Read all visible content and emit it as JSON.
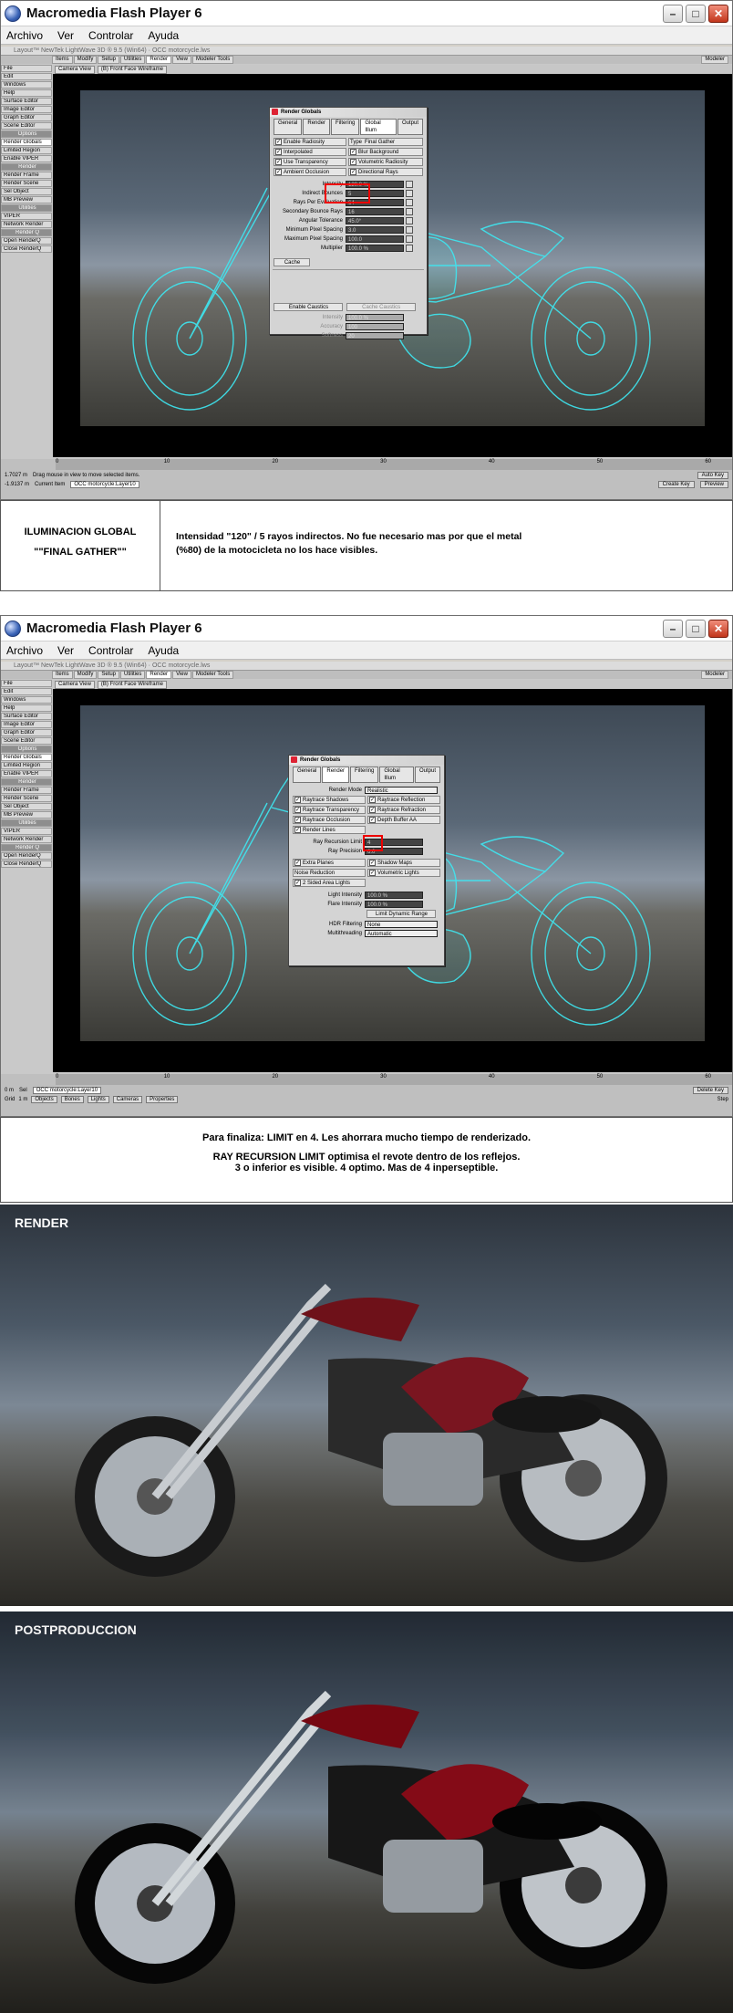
{
  "window": {
    "title": "Macromedia Flash Player 6"
  },
  "menu": [
    "Archivo",
    "Ver",
    "Controlar",
    "Ayuda"
  ],
  "lightwave": {
    "title": "Layout™ NewTek LightWave 3D ® 9.5 (Win64) · OCC motorcycle.lws",
    "tabs": [
      "Items",
      "Modify",
      "Setup",
      "Utilities",
      "Render",
      "View",
      "Modeler Tools"
    ],
    "modeler_label": "Modeler",
    "sidebar": [
      "File",
      "Edit",
      "Windows",
      "Help",
      "Surface Editor",
      "Image Editor",
      "Graph Editor",
      "Scene Editor",
      "Options",
      "Render Globals",
      "Limited Region",
      "Enable VIPER",
      "Render",
      "Render Frame",
      "Render Scene",
      "Sel Object",
      "MB Preview",
      "Utilities",
      "VIPER",
      "Network Render",
      "Render Q",
      "Open RenderQ",
      "Close RenderQ"
    ],
    "viewport_bar": [
      "Camera View",
      "(B) Front Face Wireframe"
    ],
    "timeline_ticks": [
      "0",
      "10",
      "20",
      "30",
      "40",
      "50",
      "60"
    ],
    "status_text": "Drag mouse in view to move selected items.",
    "position_label": "Position",
    "grid_label": "Grid",
    "current_item_label": "Current Item",
    "current_item_value": "OCC motorcycle:Layer10",
    "sel_label": "Sel",
    "item_buttons": [
      "Objects",
      "Bones",
      "Lights",
      "Cameras",
      "Properties"
    ],
    "key_buttons": [
      "Auto Key",
      "Create Key",
      "Delete Key"
    ],
    "preview_label": "Preview",
    "step_label": "Step",
    "x_value": "1.7027 m",
    "y_value": "0 m",
    "z_value": "-1.9137 m",
    "grid_value": "1 m"
  },
  "dialog1": {
    "title": "Render Globals",
    "tabs": [
      "General",
      "Render",
      "Filtering",
      "Global Illum",
      "Output"
    ],
    "checks_left": [
      "Enable Radiosity",
      "Interpolated",
      "Use Transparency",
      "Ambient Occlusion"
    ],
    "type_label": "Type",
    "type_value": "Final Gather",
    "checks_right": [
      "Blur Background",
      "Volumetric Radiosity",
      "Directional Rays"
    ],
    "fields": [
      {
        "label": "Intensity",
        "value": "120.0 %"
      },
      {
        "label": "Indirect Bounces",
        "value": "5"
      },
      {
        "label": "Rays Per Evaluation",
        "value": "64"
      },
      {
        "label": "Secondary Bounce Rays",
        "value": "16"
      },
      {
        "label": "Angular Tolerance",
        "value": "45.0°"
      },
      {
        "label": "Minimum Pixel Spacing",
        "value": "3.0"
      },
      {
        "label": "Maximum Pixel Spacing",
        "value": "100.0"
      },
      {
        "label": "Multiplier",
        "value": "100.0 %"
      }
    ],
    "cache_button": "Cache",
    "caustics_button": "Enable Caustics",
    "cache_caustics": "Cache Caustics",
    "caustic_fields": [
      {
        "label": "Intensity",
        "value": "100.0 %"
      },
      {
        "label": "Accuracy",
        "value": "100"
      },
      {
        "label": "Softness",
        "value": "20"
      }
    ]
  },
  "caption1": {
    "left_line1": "ILUMINACION GLOBAL",
    "left_line2": "\"\"FINAL GATHER\"\"",
    "right_line1": "Intensidad \"120\" / 5 rayos indirectos. No fue necesario mas por que el metal",
    "right_line2": "(%80) de la motocicleta no los hace visibles."
  },
  "dialog2": {
    "title": "Render Globals",
    "tabs": [
      "General",
      "Render",
      "Filtering",
      "Global Illum",
      "Output"
    ],
    "render_mode_label": "Render Mode",
    "render_mode_value": "Realistic",
    "checks_left": [
      "Raytrace Shadows",
      "Raytrace Transparency",
      "Raytrace Occlusion",
      "Render Lines"
    ],
    "checks_right": [
      "Raytrace Reflection",
      "Raytrace Refraction",
      "Depth Buffer AA"
    ],
    "ray_recursion_label": "Ray Recursion Limit",
    "ray_recursion_value": "4",
    "ray_precision_label": "Ray Precision",
    "ray_precision_value": "6.0",
    "checks2_left": [
      "Extra Planes",
      "Noise Reduction",
      "2 Sided Area Lights"
    ],
    "checks2_right": [
      "Shadow Maps",
      "Volumetric Lights"
    ],
    "light_intensity_label": "Light Intensity",
    "light_intensity_value": "100.0 %",
    "flare_intensity_label": "Flare Intensity",
    "flare_intensity_value": "100.0 %",
    "limit_range_button": "Limit Dynamic Range",
    "hdr_label": "HDR Filtering",
    "hdr_value": "None",
    "multithread_label": "Multithreading",
    "multithread_value": "Automatic"
  },
  "caption2": {
    "line1": "Para finaliza: LIMIT en 4. Les ahorrara mucho tiempo de renderizado.",
    "line2": "RAY RECURSION LIMIT optimisa el revote dentro de los reflejos.",
    "line3": "3 o inferior es visible. 4 optimo. Mas de 4 inperseptible."
  },
  "render_label": "RENDER",
  "post_label": "POSTPRODUCCION",
  "colors": {
    "wireframe": "#3ee8f2",
    "highlight": "#e00000",
    "bike_red": "#6e1119"
  }
}
